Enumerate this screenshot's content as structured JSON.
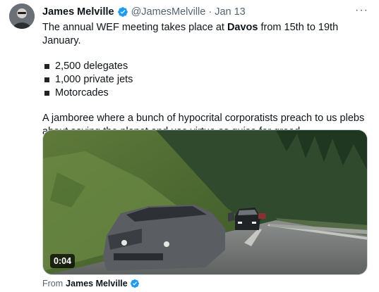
{
  "author": {
    "display_name": "James Melville",
    "handle": "@JamesMelville",
    "separator": "·",
    "date": "Jan 13",
    "verified_icon": "verified-badge-icon"
  },
  "more_icon": "···",
  "tweet": {
    "line1_before": "The annual WEF meeting takes place at ",
    "line1_bold": "Davos",
    "line1_after": " from 15th to 19th January.",
    "bullets": [
      "2,500 delegates",
      "1,000 private jets",
      "Motorcades"
    ],
    "paragraph": "A jamboree where a bunch of hypocrital corporatists preach to us plebs about saving the planet and use virtue as guise for greed."
  },
  "media": {
    "duration": "0:04"
  },
  "from": {
    "prefix": "From",
    "name": "James Melville"
  },
  "colors": {
    "verified_blue": "#1d9bf0",
    "secondary_text": "#536471",
    "primary_text": "#0f1419"
  }
}
